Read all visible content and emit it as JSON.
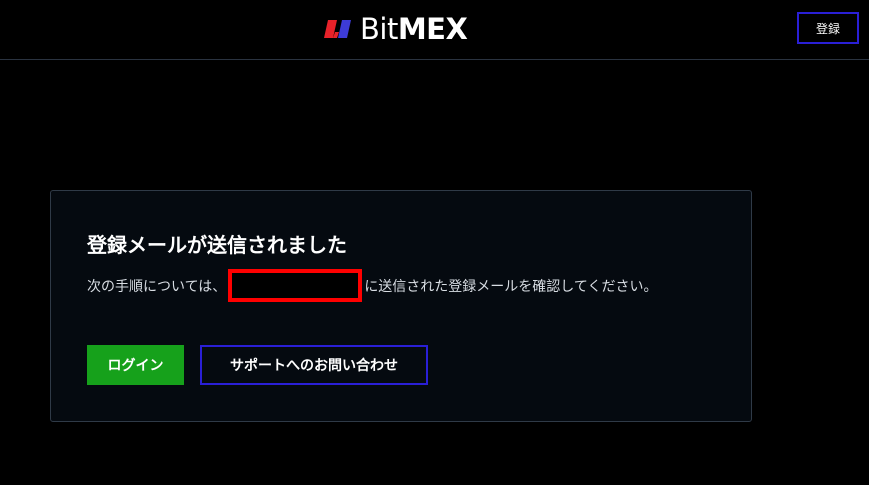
{
  "header": {
    "logo": {
      "text_light": "Bit",
      "text_bold": "MEX",
      "mark_icon": "bitmex-logo-icon",
      "mark_colors": [
        "#e8222a",
        "#3d3bd6"
      ]
    },
    "register_label": "登録"
  },
  "card": {
    "title": "登録メールが送信されました",
    "message_prefix": "次の手順については、",
    "message_suffix": "に送信された登録メールを確認してください。",
    "login_label": "ログイン",
    "support_label": "サポートへのお問い合わせ"
  },
  "colors": {
    "background": "#000000",
    "accent_border": "#2a1fd6",
    "login_green": "#16a11b",
    "redaction_border": "#ff0000"
  }
}
